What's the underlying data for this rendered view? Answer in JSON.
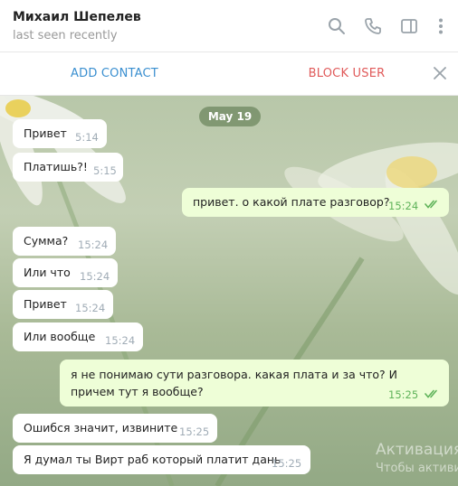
{
  "header": {
    "contact_name": "Михаил Шепелев",
    "status": "last seen recently",
    "icons": [
      "search-icon",
      "phone-icon",
      "sidebar-icon",
      "more-icon"
    ]
  },
  "action_bar": {
    "add_contact": "ADD CONTACT",
    "block_user": "BLOCK USER"
  },
  "chat": {
    "date_label": "May 19",
    "messages": [
      {
        "dir": "in",
        "text": "Привет",
        "time": "5:14"
      },
      {
        "dir": "in",
        "text": "Платишь?!",
        "time": "5:15"
      },
      {
        "dir": "out",
        "text": "привет. о какой плате разговор?",
        "time": "15:24",
        "read": true
      },
      {
        "dir": "in",
        "text": "Сумма?",
        "time": "15:24"
      },
      {
        "dir": "in",
        "text": "Или что",
        "time": "15:24"
      },
      {
        "dir": "in",
        "text": "Привет",
        "time": "15:24"
      },
      {
        "dir": "in",
        "text": "Или вообще",
        "time": "15:24"
      },
      {
        "dir": "out",
        "text": "я не понимаю сути разговора. какая плата и за что? И причем тут я вообще?",
        "time": "15:25",
        "read": true
      },
      {
        "dir": "in",
        "text": "Ошибся значит, извините",
        "time": "15:25"
      },
      {
        "dir": "in",
        "text": "Я думал ты Вирт раб который платит дань",
        "time": "15:25"
      }
    ]
  },
  "watermark": {
    "line1": "Активация",
    "line2": "Чтобы активи"
  },
  "colors": {
    "accent": "#3a8fd0",
    "danger": "#e05a5a",
    "outgoing_bubble": "#eefed7",
    "read_check": "#5fb35a"
  }
}
